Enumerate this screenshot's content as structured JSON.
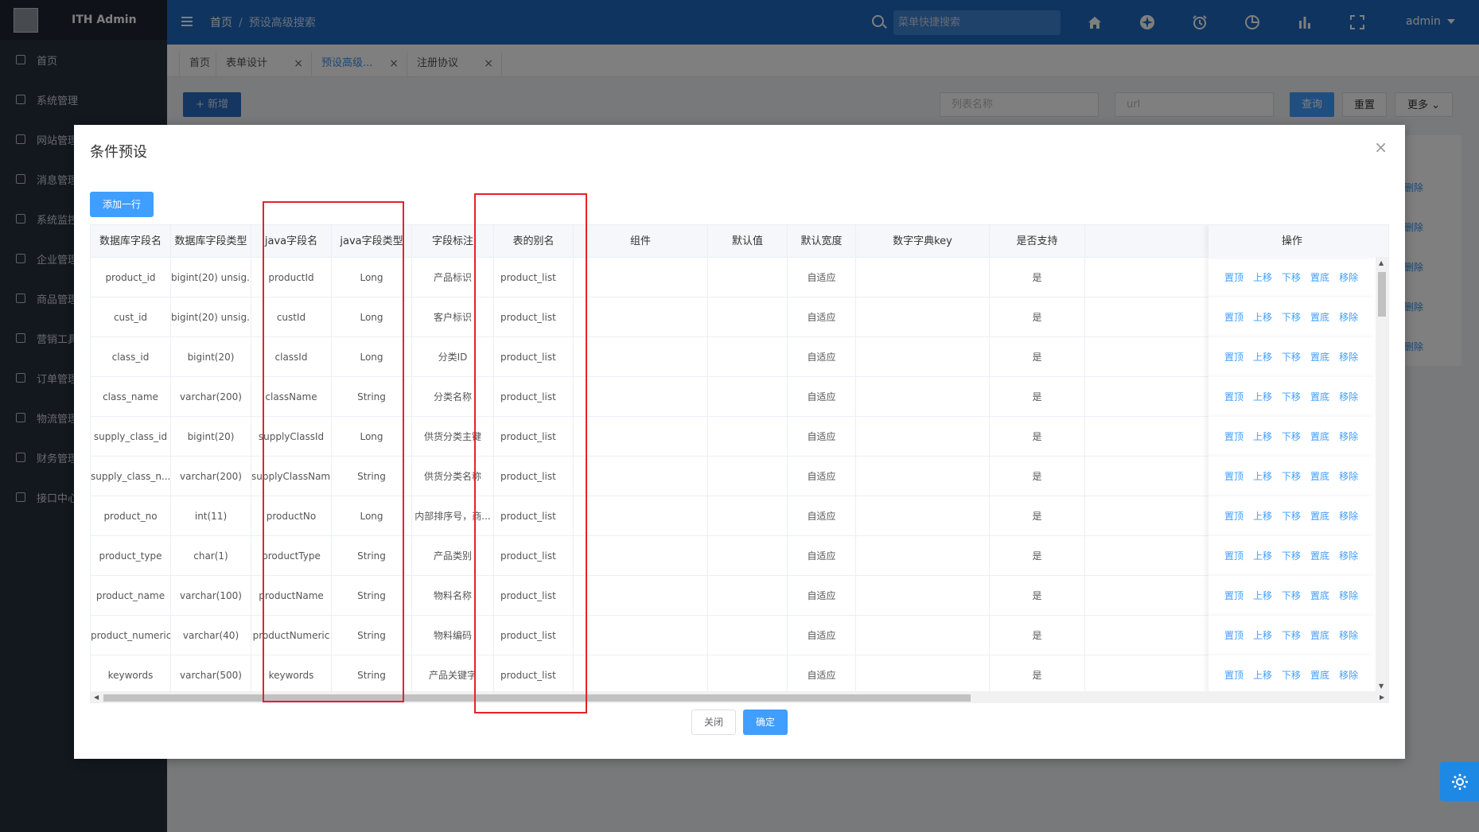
{
  "brand": {
    "name": "ITH Admin"
  },
  "sidebar": {
    "items": [
      {
        "label": "首页",
        "icon": "home-icon"
      },
      {
        "label": "系统管理",
        "icon": "settings-icon"
      },
      {
        "label": "网站管理",
        "icon": "site-icon"
      },
      {
        "label": "消息管理",
        "icon": "bell-icon"
      },
      {
        "label": "系统监控",
        "icon": "monitor-icon"
      },
      {
        "label": "企业管理",
        "icon": "building-icon"
      },
      {
        "label": "商品管理",
        "icon": "bag-icon"
      },
      {
        "label": "营销工具",
        "icon": "flag-icon"
      },
      {
        "label": "订单管理",
        "icon": "order-icon"
      },
      {
        "label": "物流管理",
        "icon": "truck-icon"
      },
      {
        "label": "财务管理",
        "icon": "finance-icon"
      },
      {
        "label": "接口中心",
        "icon": "link-icon"
      }
    ]
  },
  "header": {
    "breadcrumb": [
      "首页",
      "预设高级搜索"
    ],
    "search_placeholder": "菜单快捷搜索",
    "icons": [
      "home-icon",
      "compass-icon",
      "alarm-clock-icon",
      "pie-chart-icon",
      "bar-chart-icon",
      "fullscreen-icon"
    ],
    "user": "admin"
  },
  "tabs": [
    {
      "label": "首页",
      "closable": false,
      "active": false
    },
    {
      "label": "表单设计",
      "closable": true,
      "active": false
    },
    {
      "label": "预设高级...",
      "closable": true,
      "active": true
    },
    {
      "label": "注册协议",
      "closable": true,
      "active": false
    }
  ],
  "background_page": {
    "add_label": "+ 新增",
    "filter_name_placeholder": "列表名称",
    "filter_url_placeholder": "url",
    "query_label": "查询",
    "reset_label": "重置",
    "more_label": "更多",
    "row_action_labels": [
      "删除",
      "删除",
      "删除",
      "删除",
      "删除"
    ]
  },
  "modal": {
    "title": "条件预设",
    "add_row_label": "添加一行",
    "cancel_label": "关闭",
    "confirm_label": "确定",
    "columns": [
      "数据库字段名",
      "数据库字段类型",
      "java字段名",
      "java字段类型",
      "字段标注",
      "表的别名",
      "组件",
      "默认值",
      "默认宽度",
      "数字字典key",
      "是否支持",
      "操作"
    ],
    "row_actions": [
      "置顶",
      "上移",
      "下移",
      "置底",
      "移除"
    ],
    "rows": [
      {
        "db_field": "product_id",
        "db_type": "bigint(20) unsig...",
        "java_field": "productId",
        "java_type": "Long",
        "remark": "产品标识",
        "alias": "product_list",
        "component": "",
        "default": "",
        "width": "自适应",
        "dict_key": "",
        "support": "是"
      },
      {
        "db_field": "cust_id",
        "db_type": "bigint(20) unsig...",
        "java_field": "custId",
        "java_type": "Long",
        "remark": "客户标识",
        "alias": "product_list",
        "component": "",
        "default": "",
        "width": "自适应",
        "dict_key": "",
        "support": "是"
      },
      {
        "db_field": "class_id",
        "db_type": "bigint(20)",
        "java_field": "classId",
        "java_type": "Long",
        "remark": "分类ID",
        "alias": "product_list",
        "component": "",
        "default": "",
        "width": "自适应",
        "dict_key": "",
        "support": "是"
      },
      {
        "db_field": "class_name",
        "db_type": "varchar(200)",
        "java_field": "className",
        "java_type": "String",
        "remark": "分类名称",
        "alias": "product_list",
        "component": "",
        "default": "",
        "width": "自适应",
        "dict_key": "",
        "support": "是"
      },
      {
        "db_field": "supply_class_id",
        "db_type": "bigint(20)",
        "java_field": "supplyClassId",
        "java_type": "Long",
        "remark": "供货分类主键",
        "alias": "product_list",
        "component": "",
        "default": "",
        "width": "自适应",
        "dict_key": "",
        "support": "是"
      },
      {
        "db_field": "supply_class_n...",
        "db_type": "varchar(200)",
        "java_field": "supplyClassName",
        "java_type": "String",
        "remark": "供货分类名称",
        "alias": "product_list",
        "component": "",
        "default": "",
        "width": "自适应",
        "dict_key": "",
        "support": "是"
      },
      {
        "db_field": "product_no",
        "db_type": "int(11)",
        "java_field": "productNo",
        "java_type": "Long",
        "remark": "内部排序号，商...",
        "alias": "product_list",
        "component": "",
        "default": "",
        "width": "自适应",
        "dict_key": "",
        "support": "是"
      },
      {
        "db_field": "product_type",
        "db_type": "char(1)",
        "java_field": "productType",
        "java_type": "String",
        "remark": "产品类别",
        "alias": "product_list",
        "component": "",
        "default": "",
        "width": "自适应",
        "dict_key": "",
        "support": "是"
      },
      {
        "db_field": "product_name",
        "db_type": "varchar(100)",
        "java_field": "productName",
        "java_type": "String",
        "remark": "物料名称",
        "alias": "product_list",
        "component": "",
        "default": "",
        "width": "自适应",
        "dict_key": "",
        "support": "是"
      },
      {
        "db_field": "product_numeric",
        "db_type": "varchar(40)",
        "java_field": "productNumeric",
        "java_type": "String",
        "remark": "物料编码",
        "alias": "product_list",
        "component": "",
        "default": "",
        "width": "自适应",
        "dict_key": "",
        "support": "是"
      },
      {
        "db_field": "keywords",
        "db_type": "varchar(500)",
        "java_field": "keywords",
        "java_type": "String",
        "remark": "产品关键字",
        "alias": "product_list",
        "component": "",
        "default": "",
        "width": "自适应",
        "dict_key": "",
        "support": "是"
      }
    ]
  },
  "colors": {
    "header": "#1e69c0",
    "sidebar": "#27303f",
    "primary": "#409eff",
    "highlight": "#e8212a"
  }
}
